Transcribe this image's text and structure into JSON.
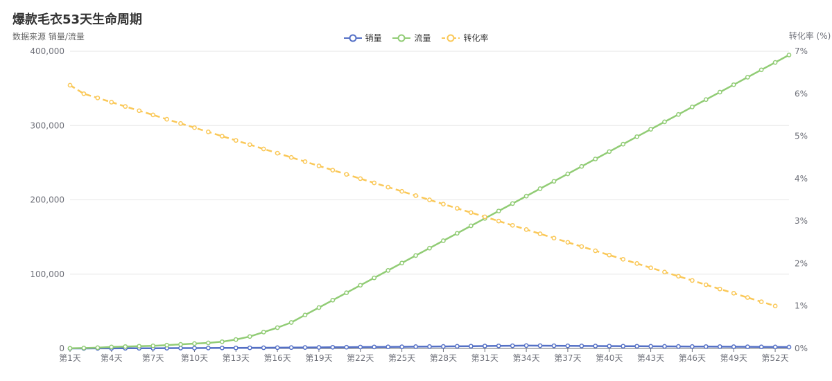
{
  "chart_data": {
    "type": "line",
    "title": "爆款毛衣53天生命周期",
    "subtitle": "数据来源   销量/流量",
    "ylabel_right": "转化率 (%)",
    "x": [
      "第1天",
      "第2天",
      "第3天",
      "第4天",
      "第5天",
      "第6天",
      "第7天",
      "第8天",
      "第9天",
      "第10天",
      "第11天",
      "第12天",
      "第13天",
      "第14天",
      "第15天",
      "第16天",
      "第17天",
      "第18天",
      "第19天",
      "第20天",
      "第21天",
      "第22天",
      "第23天",
      "第24天",
      "第25天",
      "第26天",
      "第27天",
      "第28天",
      "第29天",
      "第30天",
      "第31天",
      "第32天",
      "第33天",
      "第34天",
      "第35天",
      "第36天",
      "第37天",
      "第38天",
      "第39天",
      "第40天",
      "第41天",
      "第42天",
      "第43天",
      "第44天",
      "第45天",
      "第46天",
      "第47天",
      "第48天",
      "第49天",
      "第50天",
      "第51天",
      "第52天",
      "第53天"
    ],
    "x_tick_labels": [
      "第1天",
      "第4天",
      "第7天",
      "第10天",
      "第13天",
      "第16天",
      "第19天",
      "第22天",
      "第25天",
      "第28天",
      "第31天",
      "第34天",
      "第37天",
      "第40天",
      "第43天",
      "第46天",
      "第49天",
      "第52天"
    ],
    "y_left": {
      "min": 0,
      "max": 400000,
      "ticks": [
        "0",
        "100,000",
        "200,000",
        "300,000",
        "400,000"
      ]
    },
    "y_right": {
      "min": 0,
      "max": 7,
      "ticks": [
        "0%",
        "1%",
        "2%",
        "3%",
        "4%",
        "5%",
        "6%",
        "7%"
      ]
    },
    "grid": true,
    "legend_position": "top-center",
    "series": [
      {
        "name": "销量",
        "axis": "left",
        "color": "#5470c6",
        "dashed": false,
        "values": [
          0,
          30,
          70,
          110,
          160,
          220,
          280,
          350,
          420,
          500,
          580,
          670,
          760,
          860,
          960,
          1070,
          1180,
          1300,
          1420,
          1550,
          1680,
          1820,
          1960,
          2110,
          2260,
          2420,
          2580,
          2750,
          2920,
          3100,
          3280,
          3470,
          3660,
          3850,
          3700,
          3600,
          3500,
          3400,
          3300,
          3200,
          3100,
          3000,
          2900,
          2800,
          2700,
          2600,
          2500,
          2400,
          2300,
          2200,
          2100,
          2000,
          1900
        ]
      },
      {
        "name": "流量",
        "axis": "left",
        "color": "#91cc75",
        "dashed": false,
        "values": [
          200,
          600,
          1000,
          2000,
          2500,
          3000,
          3500,
          4500,
          5500,
          6500,
          7500,
          9000,
          12000,
          16000,
          22000,
          28000,
          35000,
          45000,
          55000,
          65000,
          75000,
          85000,
          95000,
          105000,
          115000,
          125000,
          135000,
          145000,
          155000,
          165000,
          175000,
          185000,
          195000,
          205000,
          215000,
          225000,
          235000,
          245000,
          255000,
          265000,
          275000,
          285000,
          295000,
          305000,
          315000,
          325000,
          335000,
          345000,
          355000,
          365000,
          375000,
          385000,
          395000
        ]
      },
      {
        "name": "转化率",
        "axis": "right",
        "color": "#fac858",
        "dashed": true,
        "values": [
          6.2,
          6.0,
          5.9,
          5.8,
          5.7,
          5.6,
          5.5,
          5.4,
          5.3,
          5.2,
          5.1,
          5.0,
          4.9,
          4.8,
          4.7,
          4.6,
          4.5,
          4.4,
          4.3,
          4.2,
          4.1,
          4.0,
          3.9,
          3.8,
          3.7,
          3.6,
          3.5,
          3.4,
          3.3,
          3.2,
          3.1,
          3.0,
          2.9,
          2.8,
          2.7,
          2.6,
          2.5,
          2.4,
          2.3,
          2.2,
          2.1,
          2.0,
          1.9,
          1.8,
          1.7,
          1.6,
          1.5,
          1.4,
          1.3,
          1.2,
          1.1,
          1.0
        ]
      }
    ]
  }
}
